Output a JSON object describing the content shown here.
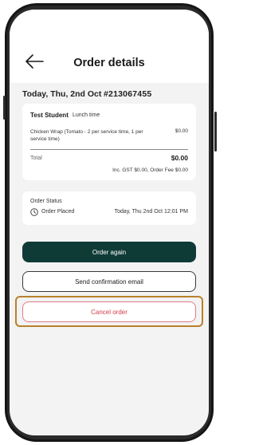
{
  "header": {
    "title": "Order details",
    "back_icon": "arrow-left-icon"
  },
  "order": {
    "date_label": "Today, Thu, 2nd Oct",
    "order_number": "#213067455",
    "student_name": "Test Student",
    "meal_time": "Lunch time",
    "item_description": "Chicken Wrap (Tomato - 2 per service time, 1 per service time)",
    "item_price": "$0.00",
    "total_label": "Total",
    "total_value": "$0.00",
    "fees_line": "Inc. GST $0.00, Order Fee $0.00"
  },
  "status": {
    "label": "Order Status",
    "value": "Order Placed",
    "timestamp": "Today, Thu 2nd Oct 12:01 PM",
    "icon": "clock-icon"
  },
  "actions": {
    "order_again": "Order again",
    "send_email": "Send confirmation email",
    "cancel_order": "Cancel order"
  },
  "colors": {
    "primary_button": "#0f3b36",
    "cancel_text": "#d43a4a",
    "cancel_border": "#e07d88",
    "highlight": "#b9802b"
  }
}
